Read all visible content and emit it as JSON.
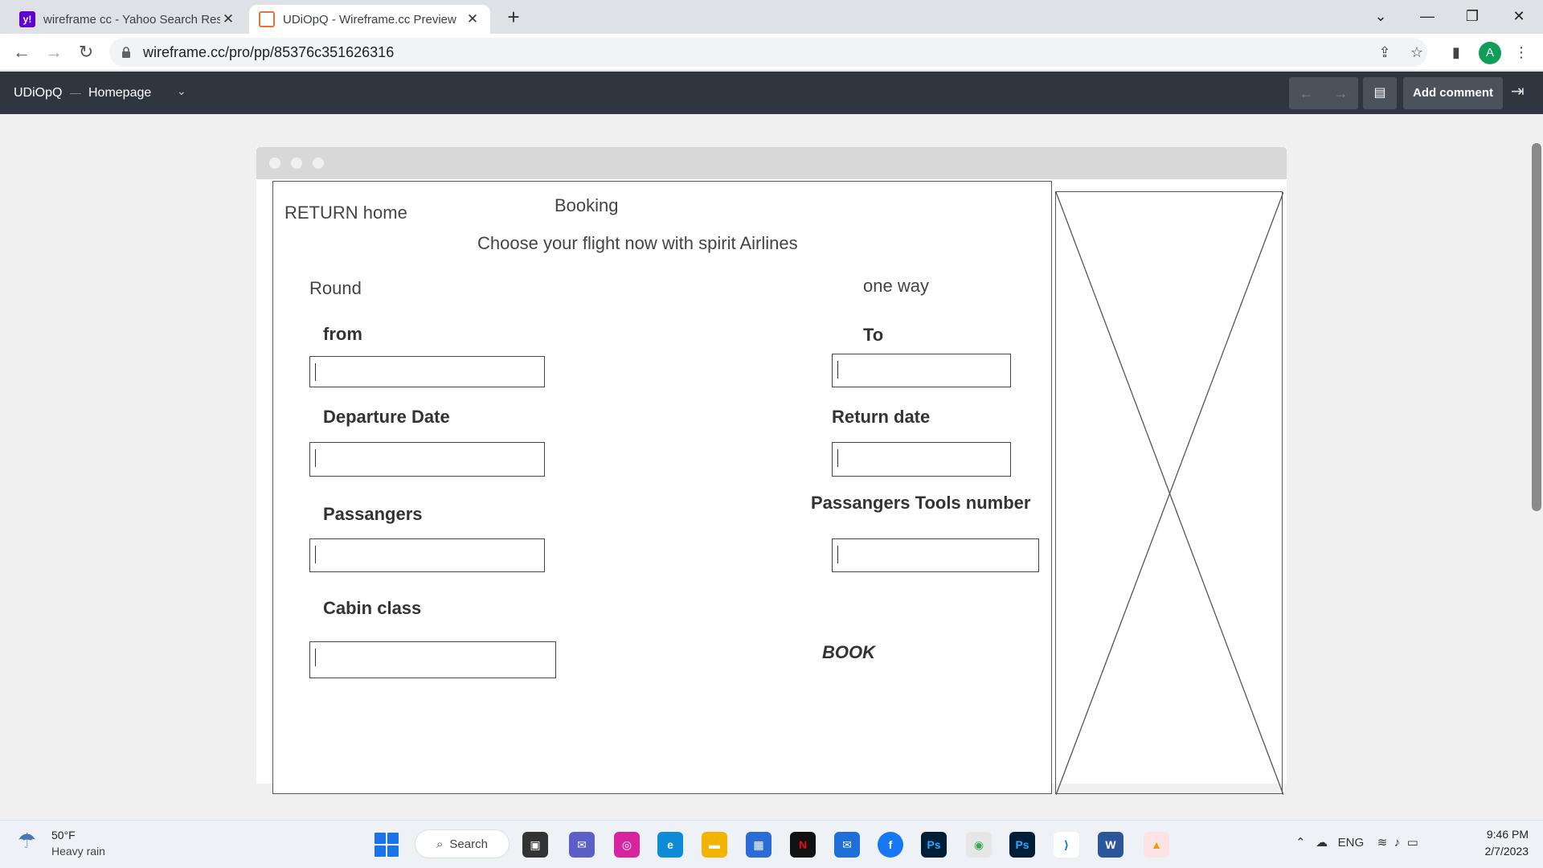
{
  "browser": {
    "tabs": [
      {
        "title": "wireframe cc - Yahoo Search Resu",
        "favicon": "yahoo-icon",
        "active": false
      },
      {
        "title": "UDiOpQ - Wireframe.cc Preview",
        "favicon": "wireframe-icon",
        "active": true
      }
    ],
    "new_tab": "+",
    "url": "wireframe.cc/pro/pp/85376c351626316",
    "profile_initial": "A"
  },
  "app_header": {
    "project_name": "UDiOpQ",
    "page_name": "Homepage",
    "add_comment_label": "Add comment"
  },
  "wireframe": {
    "return_home": "RETURN home",
    "title": "Booking",
    "subtitle": "Choose your flight now with spirit Airlines",
    "round_label": "Round",
    "one_way_label": "one way",
    "from_label": "from",
    "to_label": "To",
    "departure_label": "Departure Date",
    "return_date_label": "Return date",
    "passengers_label": "Passangers",
    "passengers_tools_label": "Passangers Tools number",
    "cabin_label": "Cabin class",
    "book_label": "BOOK"
  },
  "taskbar": {
    "weather_temp": "50°F",
    "weather_desc": "Heavy rain",
    "search_label": "Search",
    "language": "ENG",
    "time": "9:46 PM",
    "date": "2/7/2023"
  },
  "colors": {
    "app_header_bg": "#2f3640",
    "chrome_tabstrip": "#dee1e6",
    "wireframe_stroke": "#444444"
  }
}
